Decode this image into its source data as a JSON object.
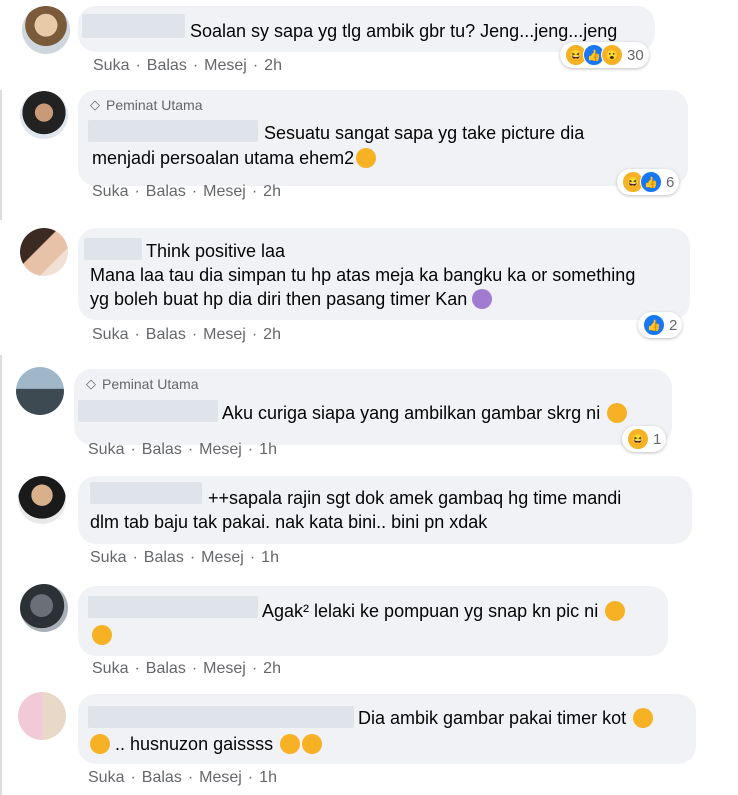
{
  "actions": {
    "like": "Suka",
    "reply": "Balas",
    "message": "Mesej",
    "dot": "·"
  },
  "badge_label": "Peminat Utama",
  "comments": [
    {
      "text1": "Soalan sy sapa yg tlg ambik gbr tu? Jeng...jeng...jeng",
      "time": "2h",
      "react_count": "30"
    },
    {
      "badge": true,
      "text1": "Sesuatu sangat sapa yg take picture dia",
      "text2": "menjadi persoalan utama ehem2",
      "time": "2h",
      "react_count": "6"
    },
    {
      "text1": "Think positive laa",
      "text2": "Mana laa tau dia simpan tu hp atas meja ka bangku ka or something",
      "text3": "yg boleh buat hp dia diri then pasang timer Kan",
      "time": "2h",
      "react_count": "2"
    },
    {
      "badge": true,
      "text1": "Aku curiga siapa yang ambilkan gambar skrg ni",
      "time": "1h",
      "react_count": "1"
    },
    {
      "text1": "++sapala rajin sgt dok amek gambaq hg time mandi",
      "text2": "dlm tab baju tak pakai. nak kata bini.. bini pn xdak",
      "time": "1h"
    },
    {
      "text1": "Agak² lelaki ke pompuan yg snap kn pic ni",
      "time": "2h"
    },
    {
      "text1": "Dia ambik gambar pakai timer kot",
      "text2": ".. husnuzon gaissss",
      "time": "1h"
    }
  ],
  "icons": {
    "badge": "diamond-icon",
    "like": "like-icon",
    "haha": "haha-icon",
    "wow": "wow-icon"
  },
  "colors": {
    "bubble": "#f0f2f5",
    "meta": "#65676b",
    "like_blue": "#1877f2",
    "emoji_yellow": "#f7b125"
  }
}
